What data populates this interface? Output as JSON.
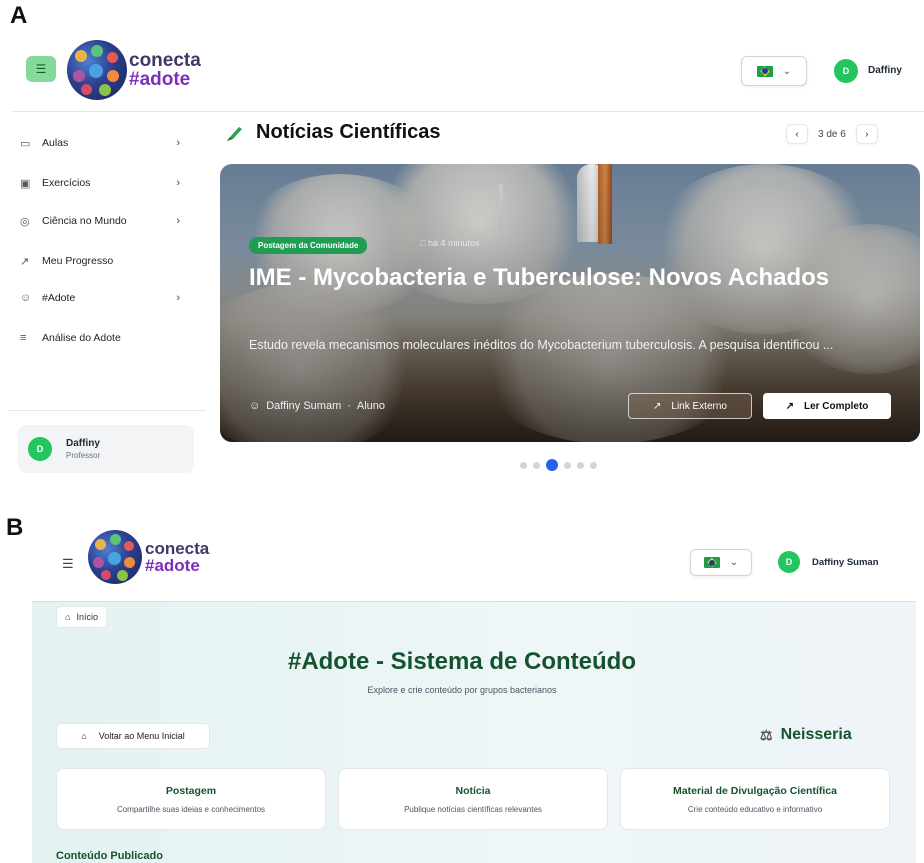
{
  "labels": {
    "a": "A",
    "b": "B"
  },
  "brand": {
    "line1": "conecta",
    "line2": "#adote"
  },
  "panel_a": {
    "user_name": "Daffiny",
    "avatar_letter": "D",
    "sidebar": [
      {
        "icon": "monitor-icon",
        "label": "Aulas",
        "has_arrow": true
      },
      {
        "icon": "shapes-icon",
        "label": "Exercícios",
        "has_arrow": true
      },
      {
        "icon": "globe-icon",
        "label": "Ciência no Mundo",
        "has_arrow": true
      },
      {
        "icon": "trend-icon",
        "label": "Meu Progresso",
        "has_arrow": false
      },
      {
        "icon": "person-icon",
        "label": "#Adote",
        "has_arrow": true
      },
      {
        "icon": "chart-icon",
        "label": "Análise do Adote",
        "has_arrow": false
      }
    ],
    "sidebar_user": {
      "name": "Daffiny",
      "role": "Professor",
      "avatar": "D"
    },
    "section_title": "Notícias Científicas",
    "pager": {
      "text": "3 de 6",
      "prev": "‹",
      "next": "›"
    },
    "hero": {
      "tag": "Postagem da Comunidade",
      "time": "há 4 minutos",
      "title": "IME - Mycobacteria e Tuberculose: Novos Achados",
      "description": "Estudo revela mecanismos moleculares inéditos do Mycobacterium tuberculosis. A pesquisa identificou ...",
      "author": "Daffiny Sumam",
      "author_role": "Aluno",
      "btn_external": "Link Externo",
      "btn_read": "Ler Completo"
    },
    "carousel": {
      "total": 6,
      "active": 3
    }
  },
  "panel_b": {
    "user_name": "Daffiny Suman",
    "avatar_letter": "D",
    "breadcrumb": "Início",
    "title": "#Adote - Sistema de Conteúdo",
    "subtitle": "Explore e crie conteúdo por grupos bacterianos",
    "back_button": "Voltar ao Menu Inicial",
    "group": "Neisseria",
    "cards": [
      {
        "title": "Postagem",
        "desc": "Compartilhe suas ideias e conhecimentos"
      },
      {
        "title": "Notícia",
        "desc": "Publique notícias científicas relevantes"
      },
      {
        "title": "Material de Divulgação Científica",
        "desc": "Crie conteúdo educativo e informativo"
      }
    ],
    "published_heading": "Conteúdo Publicado"
  },
  "colors": {
    "accent_green": "#22c55e",
    "title_green": "#14532d",
    "active_dot": "#2563eb",
    "tag_green": "#1f9d55"
  }
}
